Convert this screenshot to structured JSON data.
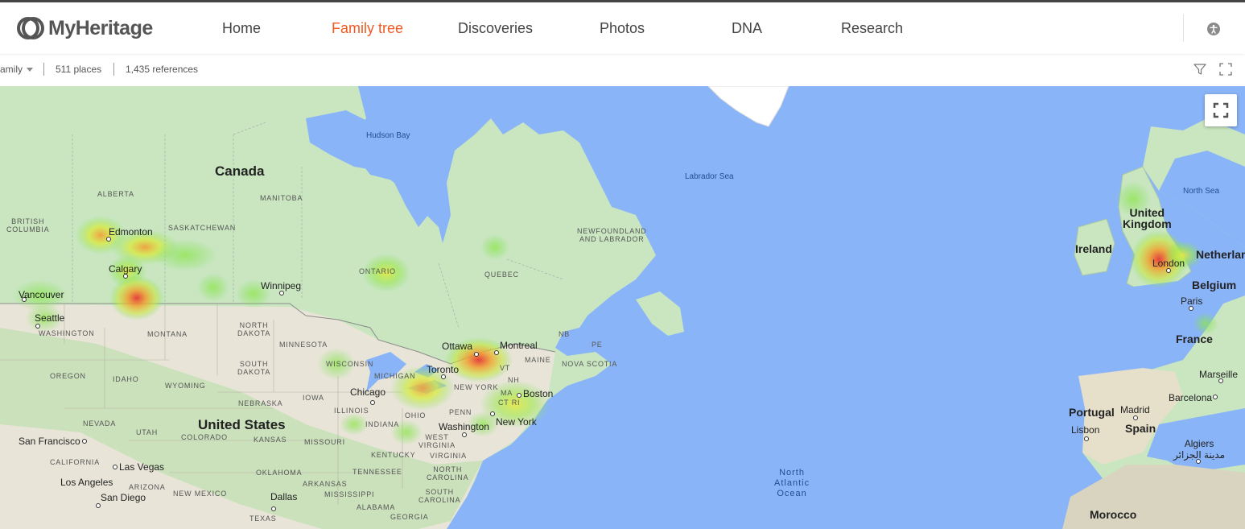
{
  "brand": {
    "name": "MyHeritage"
  },
  "nav": {
    "items": [
      {
        "label": "Home",
        "active": false
      },
      {
        "label": "Family tree",
        "active": true
      },
      {
        "label": "Discoveries",
        "active": false
      },
      {
        "label": "Photos",
        "active": false
      },
      {
        "label": "DNA",
        "active": false
      },
      {
        "label": "Research",
        "active": false
      }
    ]
  },
  "toolbar": {
    "scope_label": "amily",
    "places": "511 places",
    "references": "1,435 references"
  },
  "map": {
    "labels": {
      "canada": "Canada",
      "united_states": "United States",
      "hudson_bay": "Hudson Bay",
      "labrador_sea": "Labrador Sea",
      "north_sea": "North Sea",
      "north_atlantic": "North\nAtlantic\nOcean",
      "alberta": "ALBERTA",
      "manitoba": "MANITOBA",
      "saskatchewan": "SASKATCHEWAN",
      "british_columbia": "BRITISH\nCOLUMBIA",
      "ontario": "ONTARIO",
      "quebec": "QUEBEC",
      "newfoundland": "NEWFOUNDLAND\nAND LABRADOR",
      "nb": "NB",
      "pe": "PE",
      "nova_scotia": "NOVA SCOTIA",
      "edmonton": "Edmonton",
      "calgary": "Calgary",
      "vancouver": "Vancouver",
      "seattle": "Seattle",
      "winnipeg": "Winnipeg",
      "ottawa": "Ottawa",
      "montreal": "Montreal",
      "toronto": "Toronto",
      "boston": "Boston",
      "new_york": "New York",
      "washington": "Washington",
      "chicago": "Chicago",
      "san_francisco": "San Francisco",
      "las_vegas": "Las Vegas",
      "los_angeles": "Los Angeles",
      "san_diego": "San Diego",
      "dallas": "Dallas",
      "washington_st": "WASHINGTON",
      "montana": "MONTANA",
      "north_dakota": "NORTH\nDAKOTA",
      "south_dakota": "SOUTH\nDAKOTA",
      "minnesota": "MINNESOTA",
      "wisconsin": "WISCONSIN",
      "michigan": "MICHIGAN",
      "oregon": "OREGON",
      "idaho": "IDAHO",
      "wyoming": "WYOMING",
      "nebraska": "NEBRASKA",
      "iowa": "IOWA",
      "illinois": "ILLINOIS",
      "indiana": "INDIANA",
      "ohio": "OHIO",
      "penn": "PENN",
      "new_york_st": "NEW YORK",
      "vt": "VT",
      "nh": "NH",
      "maine": "MAINE",
      "ma": "MA",
      "ct_ri": "CT RI",
      "nevada": "NEVADA",
      "utah": "UTAH",
      "colorado": "COLORADO",
      "kansas": "KANSAS",
      "missouri": "MISSOURI",
      "west_virginia": "WEST\nVIRGINIA",
      "virginia": "VIRGINIA",
      "kentucky": "KENTUCKY",
      "tennessee": "TENNESSEE",
      "north_carolina": "NORTH\nCAROLINA",
      "south_carolina": "SOUTH\nCAROLINA",
      "california": "CALIFORNIA",
      "arizona": "ARIZONA",
      "new_mexico": "NEW MEXICO",
      "oklahoma": "OKLAHOMA",
      "arkansas": "ARKANSAS",
      "mississippi": "MISSISSIPPI",
      "alabama": "ALABAMA",
      "georgia": "GEORGIA",
      "texas": "TEXAS",
      "ireland": "Ireland",
      "united_kingdom": "United\nKingdom",
      "london": "London",
      "netherlands": "Netherlan",
      "belgium": "Belgium",
      "paris": "Paris",
      "france": "France",
      "marseille": "Marseille",
      "barcelona": "Barcelona",
      "portugal": "Portugal",
      "lisbon": "Lisbon",
      "madrid": "Madrid",
      "spain": "Spain",
      "algiers": "Algiers\nمدينة الجزائر",
      "morocco": "Morocco"
    }
  }
}
